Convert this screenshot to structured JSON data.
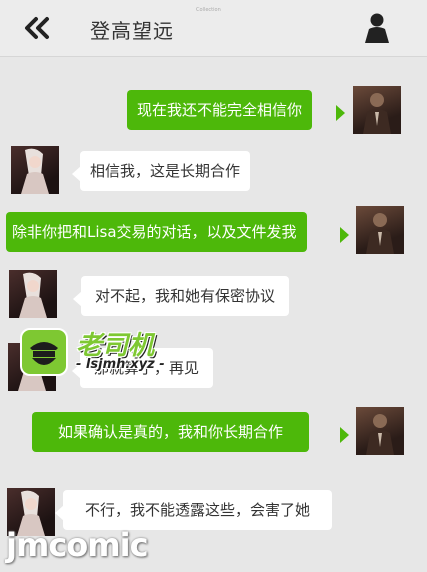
{
  "header": {
    "title": "登高望远",
    "tiny_text": "Collection",
    "back_icon": "double-chevron-left-icon",
    "user_icon": "person-icon"
  },
  "messages": [
    {
      "sender": "me",
      "text": "现在我还不能完全相信你"
    },
    {
      "sender": "her",
      "text": "相信我，这是长期合作"
    },
    {
      "sender": "me",
      "text": "除非你把和Lisa交易的对话，以及文件发我"
    },
    {
      "sender": "her",
      "text": "对不起，我和她有保密协议"
    },
    {
      "sender": "her",
      "text": "那就算了，再见"
    },
    {
      "sender": "me",
      "text": "如果确认是真的，我和你长期合作"
    },
    {
      "sender": "her",
      "text": "不行，我不能透露这些，会害了她"
    }
  ],
  "watermark": {
    "brand": "老司机",
    "url": "- lsjmh.xyz -",
    "site": "jmcomic"
  },
  "colors": {
    "green_bubble": "#4db80a",
    "white_bubble": "#ffffff",
    "background": "#e7e7e7"
  }
}
